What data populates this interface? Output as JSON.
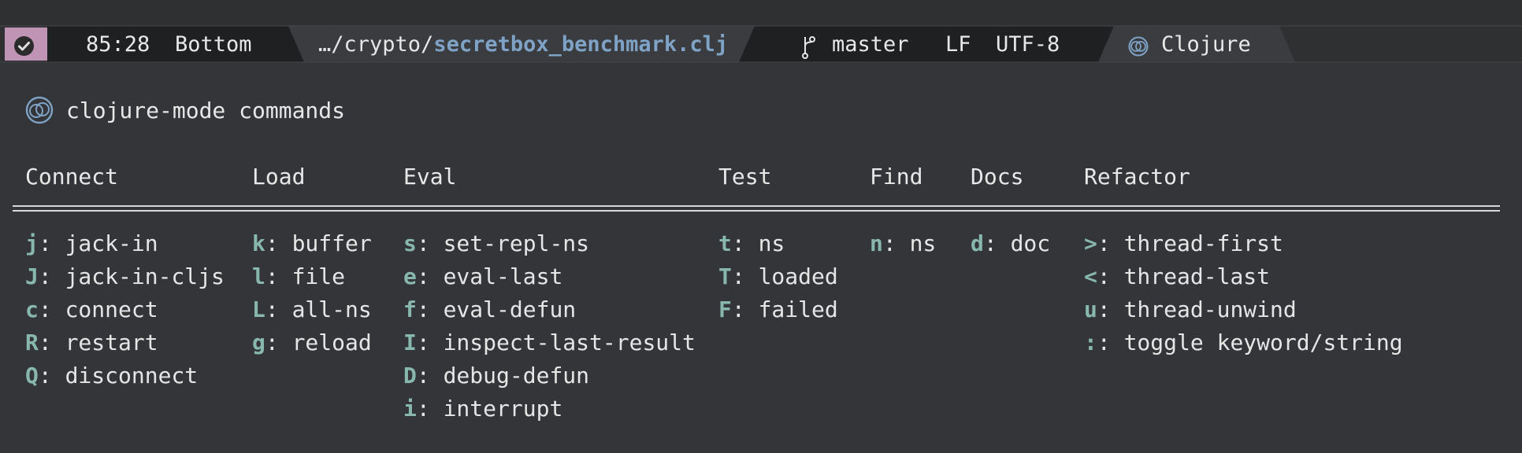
{
  "modeline": {
    "position": "85:28",
    "scroll": "Bottom",
    "file_dir": "…/crypto/",
    "file_name": "secretbox_benchmark.clj",
    "branch": "master",
    "eol": "LF",
    "encoding": "UTF-8",
    "major_mode": "Clojure"
  },
  "popup": {
    "title": "clojure-mode commands",
    "columns": [
      {
        "header": "Connect",
        "items": [
          {
            "key": "j",
            "label": "jack-in"
          },
          {
            "key": "J",
            "label": "jack-in-cljs"
          },
          {
            "key": "c",
            "label": "connect"
          },
          {
            "key": "R",
            "label": "restart"
          },
          {
            "key": "Q",
            "label": "disconnect"
          }
        ]
      },
      {
        "header": "Load",
        "items": [
          {
            "key": "k",
            "label": "buffer"
          },
          {
            "key": "l",
            "label": "file"
          },
          {
            "key": "L",
            "label": "all-ns"
          },
          {
            "key": "g",
            "label": "reload"
          }
        ]
      },
      {
        "header": "Eval",
        "items": [
          {
            "key": "s",
            "label": "set-repl-ns"
          },
          {
            "key": "e",
            "label": "eval-last"
          },
          {
            "key": "f",
            "label": "eval-defun"
          },
          {
            "key": "I",
            "label": "inspect-last-result"
          },
          {
            "key": "D",
            "label": "debug-defun"
          },
          {
            "key": "i",
            "label": "interrupt"
          }
        ]
      },
      {
        "header": "Test",
        "items": [
          {
            "key": "t",
            "label": "ns"
          },
          {
            "key": "T",
            "label": "loaded"
          },
          {
            "key": "F",
            "label": "failed"
          }
        ]
      },
      {
        "header": "Find",
        "items": [
          {
            "key": "n",
            "label": "ns"
          }
        ]
      },
      {
        "header": "Docs",
        "items": [
          {
            "key": "d",
            "label": "doc"
          }
        ]
      },
      {
        "header": "Refactor",
        "items": [
          {
            "key": ">",
            "label": "thread-first"
          },
          {
            "key": "<",
            "label": "thread-last"
          },
          {
            "key": "u",
            "label": "thread-unwind"
          },
          {
            "key": ":",
            "label": "toggle keyword/string"
          }
        ]
      }
    ]
  },
  "colors": {
    "background": "#333538",
    "key": "#88b8ad",
    "file_name": "#7fa3c6",
    "status_badge": "#c79ab8"
  }
}
